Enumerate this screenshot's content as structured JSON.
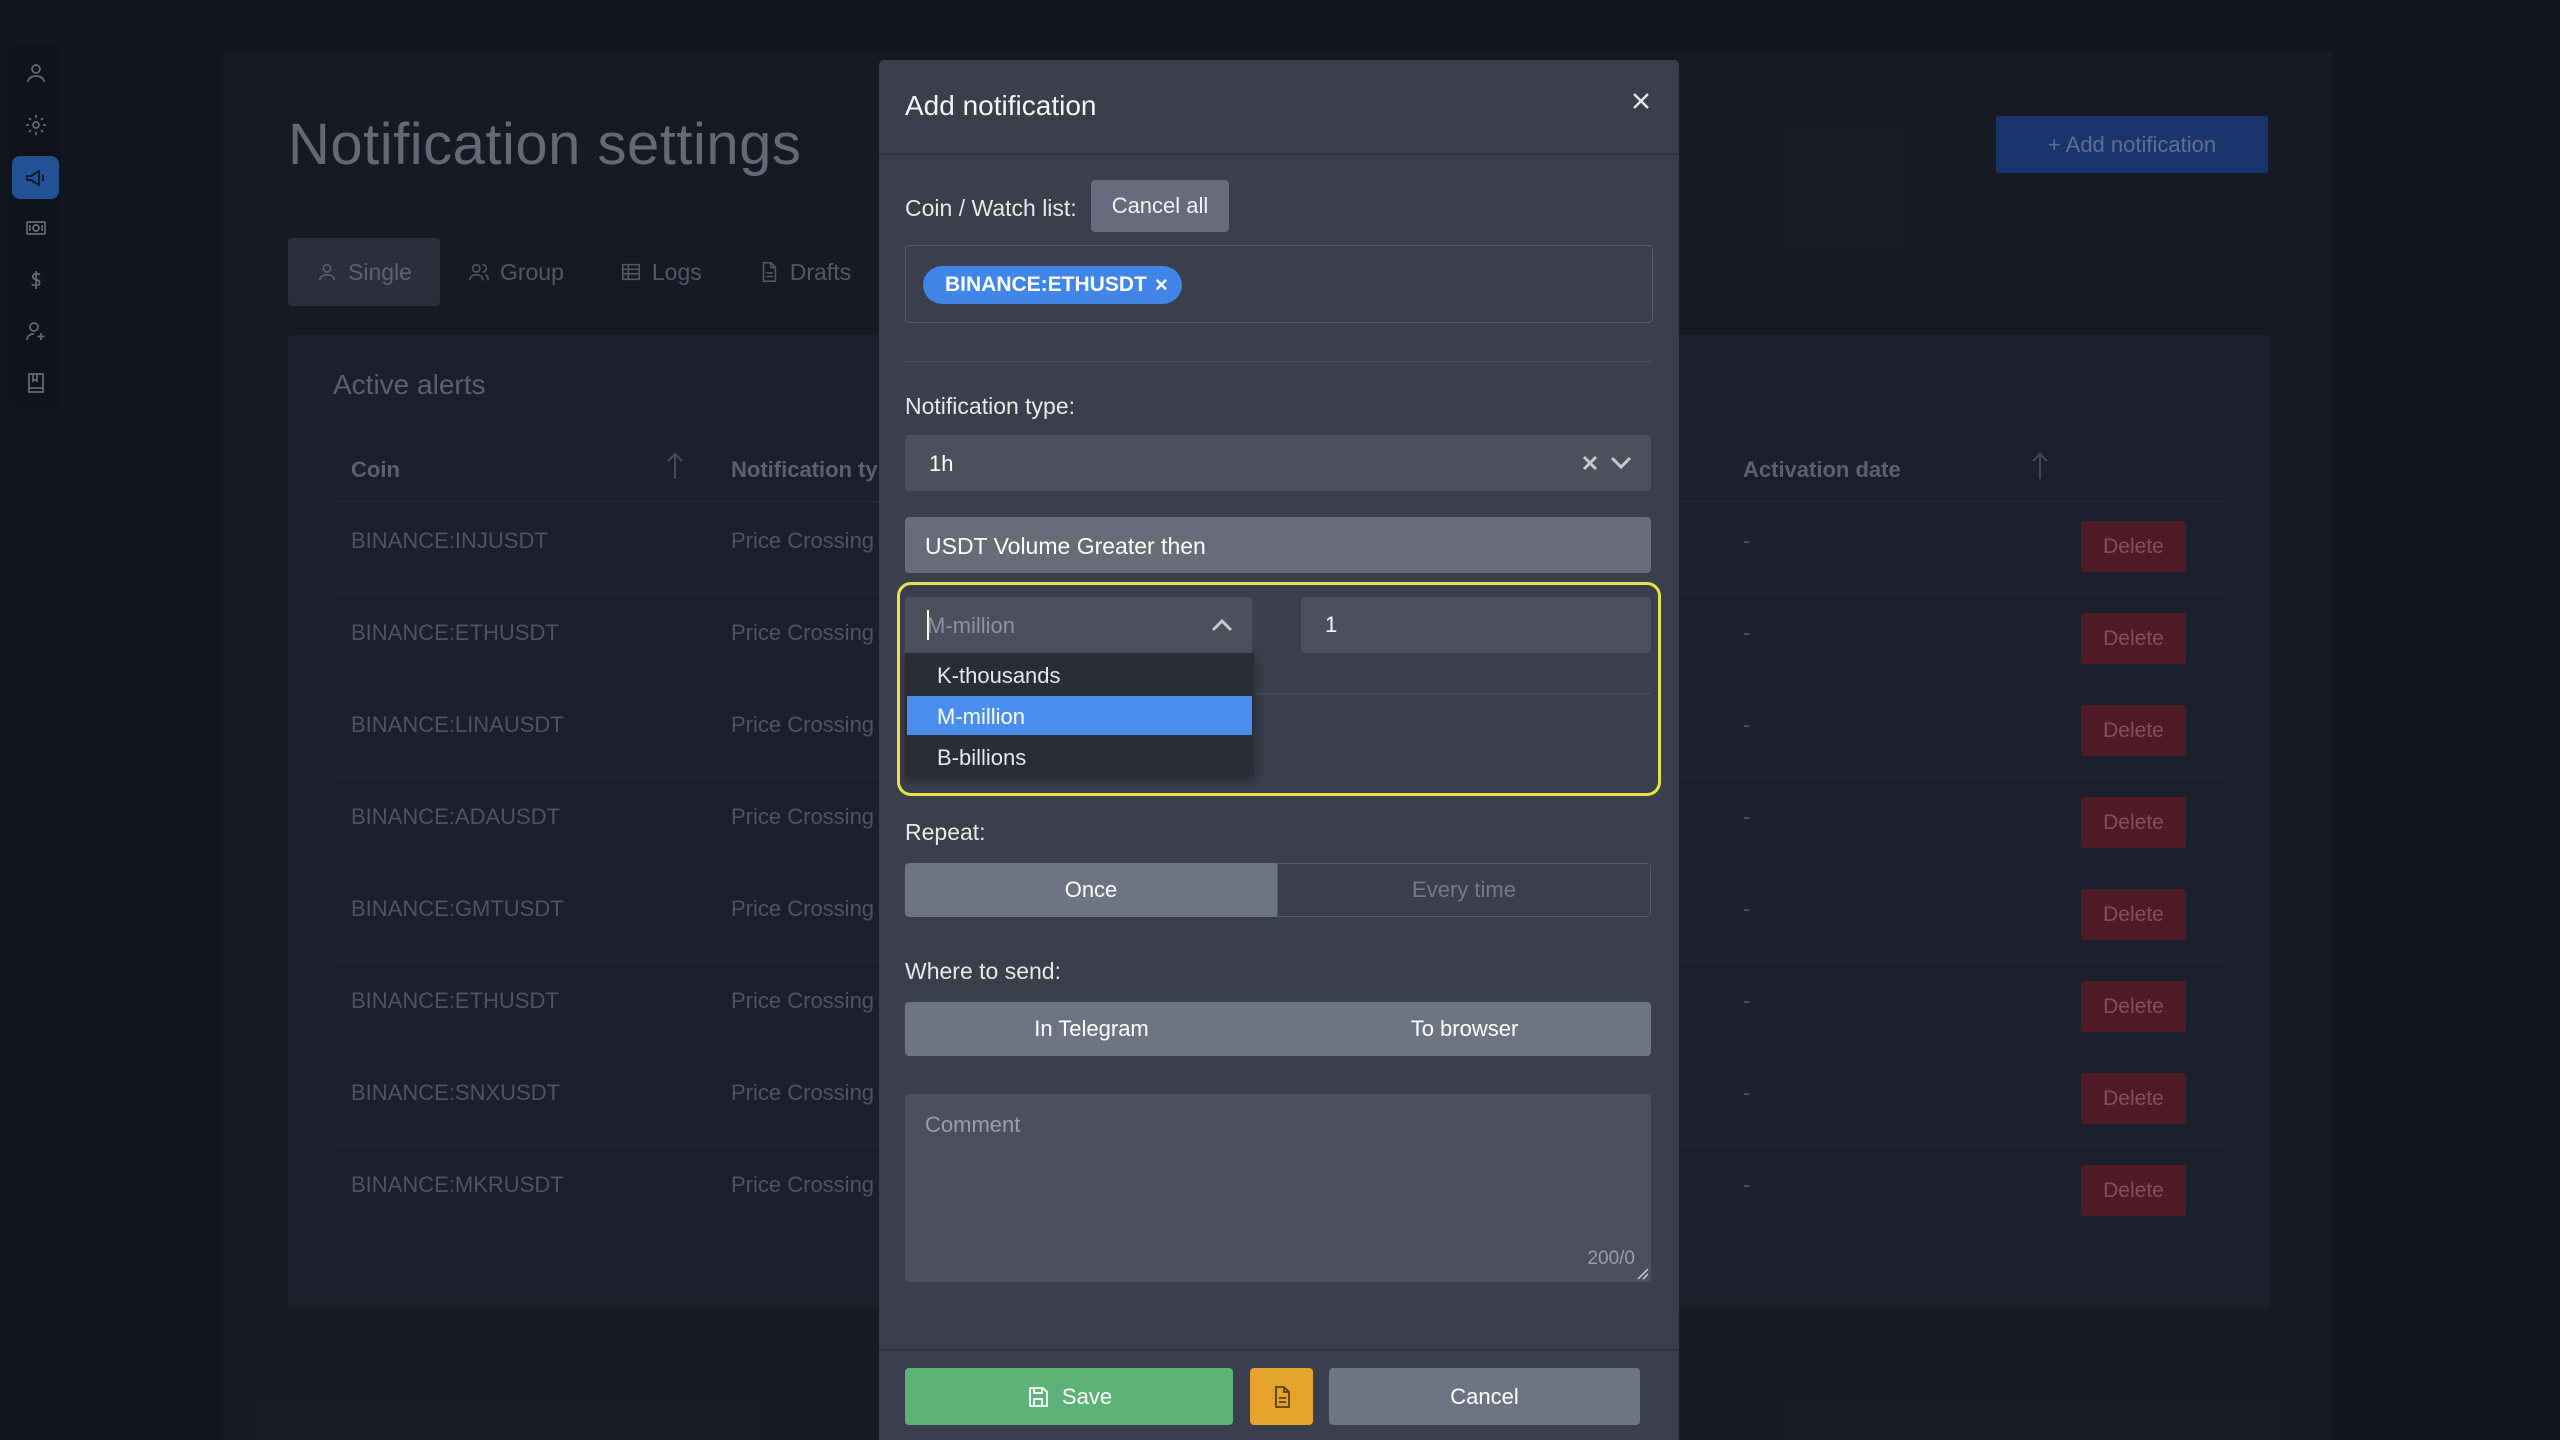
{
  "page": {
    "title": "Notification settings",
    "add_notification_label": "+ Add notification",
    "tabs": [
      {
        "label": "Single",
        "icon": "user-icon"
      },
      {
        "label": "Group",
        "icon": "group-icon"
      },
      {
        "label": "Logs",
        "icon": "table-icon"
      },
      {
        "label": "Drafts",
        "icon": "document-icon"
      }
    ],
    "active_alerts_title": "Active alerts",
    "table": {
      "headers": [
        "Coin",
        "Notification ty",
        "Activation date"
      ],
      "rows": [
        {
          "coin": "BINANCE:INJUSDT",
          "type": "Price Crossing",
          "date": "-",
          "action": "Delete"
        },
        {
          "coin": "BINANCE:ETHUSDT",
          "type": "Price Crossing",
          "date": "-",
          "action": "Delete"
        },
        {
          "coin": "BINANCE:LINAUSDT",
          "type": "Price Crossing",
          "date": "-",
          "action": "Delete"
        },
        {
          "coin": "BINANCE:ADAUSDT",
          "type": "Price Crossing",
          "date": "-",
          "action": "Delete"
        },
        {
          "coin": "BINANCE:GMTUSDT",
          "type": "Price Crossing",
          "date": "-",
          "action": "Delete"
        },
        {
          "coin": "BINANCE:ETHUSDT",
          "type": "Price Crossing",
          "date": "-",
          "action": "Delete"
        },
        {
          "coin": "BINANCE:SNXUSDT",
          "type": "Price Crossing",
          "date": "-",
          "action": "Delete"
        },
        {
          "coin": "BINANCE:MKRUSDT",
          "type": "Price Crossing",
          "date": "-",
          "action": "Delete"
        }
      ]
    }
  },
  "sidebar": {
    "icons": [
      "user-icon",
      "gear-icon",
      "megaphone-icon",
      "money-icon",
      "dollar-icon",
      "add-user-icon",
      "book-icon"
    ],
    "active": "megaphone-icon"
  },
  "modal": {
    "title": "Add notification",
    "coin_label": "Coin / Watch list:",
    "cancel_all_label": "Cancel all",
    "selected_coin": "BINANCE:ETHUSDT",
    "notification_type_label": "Notification type:",
    "notification_type_value": "1h",
    "condition_value": "USDT Volume Greater then",
    "unit_placeholder": "M-million",
    "unit_options": [
      "K-thousands",
      "M-million",
      "B-billions"
    ],
    "unit_selected": "M-million",
    "amount_value": "1",
    "repeat_label": "Repeat:",
    "repeat_options": [
      "Once",
      "Every time"
    ],
    "repeat_selected": "Once",
    "send_label": "Where to send:",
    "send_options": [
      "In Telegram",
      "To browser"
    ],
    "comment_placeholder": "Comment",
    "comment_counter": "200/0",
    "save_label": "Save",
    "cancel_label": "Cancel"
  },
  "colors": {
    "accent": "#3f86e8",
    "save": "#5cb277",
    "draft": "#e6a42e",
    "highlight": "#e8e24c",
    "delete": "#6a2330"
  }
}
